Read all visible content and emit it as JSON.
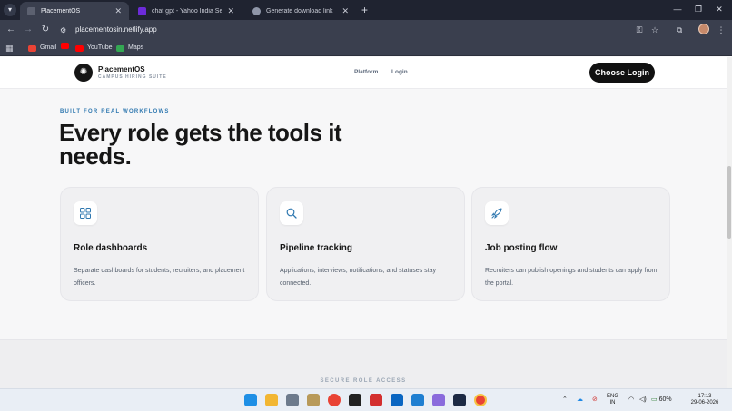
{
  "browser": {
    "tabs": [
      {
        "title": "PlacementOS",
        "active": true,
        "favicon_color": "#5c6170"
      },
      {
        "title": "chat gpt - Yahoo India Search R",
        "active": false,
        "favicon_color": "#6c2bd9"
      },
      {
        "title": "Generate download link",
        "active": false,
        "favicon_color": "#8f96a8"
      }
    ],
    "url": "placementosin.netlify.app",
    "bookmarks": [
      {
        "label": "Gmail",
        "color": "#ea4335"
      },
      {
        "label": "",
        "color": "#ff0000"
      },
      {
        "label": "YouTube",
        "color": "#ff0000"
      },
      {
        "label": "Maps",
        "color": "#34a853"
      }
    ]
  },
  "site": {
    "brand": "PlacementOS",
    "tagline": "CAMPUS HIRING SUITE",
    "nav": [
      "Platform",
      "Login"
    ],
    "cta": "Choose Login"
  },
  "section": {
    "eyebrow": "BUILT FOR REAL WORKFLOWS",
    "headline": "Every role gets the tools it needs.",
    "cards": [
      {
        "title": "Role dashboards",
        "desc": "Separate dashboards for students, recruiters, and placement officers.",
        "icon": "grid-icon"
      },
      {
        "title": "Pipeline tracking",
        "desc": "Applications, interviews, notifications, and statuses stay connected.",
        "icon": "search-icon"
      },
      {
        "title": "Job posting flow",
        "desc": "Recruiters can publish openings and students can apply from the portal.",
        "icon": "rocket-icon"
      }
    ]
  },
  "next_section": {
    "eyebrow": "SECURE ROLE ACCESS"
  },
  "taskbar": {
    "lang_1": "ENG",
    "lang_2": "IN",
    "battery": "60%",
    "time": "17:13",
    "date": "29-06-2026"
  },
  "colors": {
    "accent": "#2f78b0",
    "cta_bg": "#111111"
  }
}
